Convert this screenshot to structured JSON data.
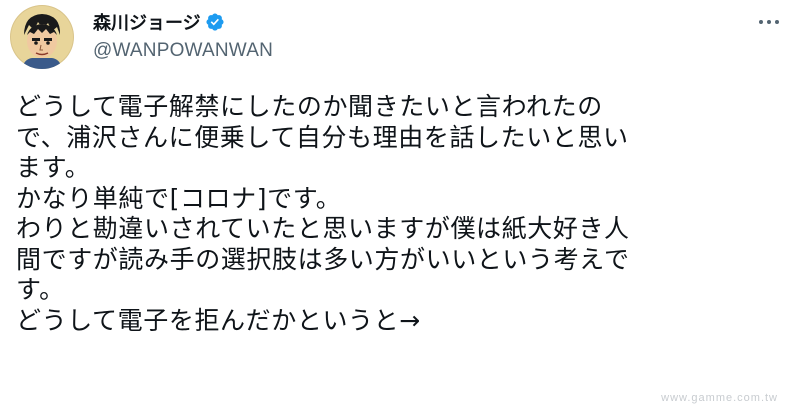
{
  "tweet": {
    "author": {
      "display_name": "森川ジョージ",
      "handle": "@WANPOWANWAN",
      "verified_icon": "verified-badge-icon",
      "avatar_icon": "avatar"
    },
    "more_icon": "more-options-icon",
    "text_lines": [
      "どうして電子解禁にしたのか聞きたいと言われたの",
      "で、浦沢さんに便乗して自分も理由を話したいと思い",
      "ます。",
      "かなり単純で[コロナ]です。",
      "わりと勘違いされていたと思いますが僕は紙大好き人",
      "間ですが読み手の選択肢は多い方がいいという考えで",
      "す。",
      "どうして電子を拒んだかというと→"
    ]
  },
  "watermark": "www.gamme.com.tw",
  "colors": {
    "text": "#0f1419",
    "secondary": "#536471",
    "verified": "#1d9bf0"
  }
}
